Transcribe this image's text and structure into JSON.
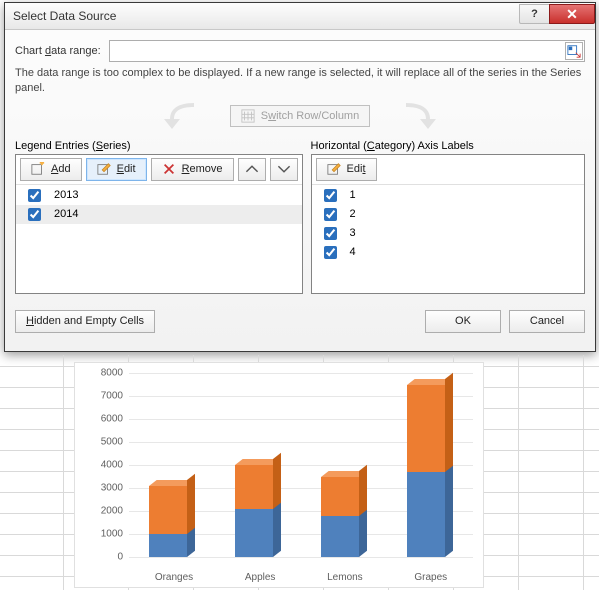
{
  "dialog": {
    "title": "Select Data Source",
    "help_tip": "?",
    "close_tip": "X",
    "range_label_pre": "Chart ",
    "range_label_u": "d",
    "range_label_post": "ata range:",
    "range_value": "",
    "note": "The data range is too complex to be displayed. If a new range is selected, it will replace all of the series in the Series panel.",
    "switch_label_pre": "S",
    "switch_label_u": "w",
    "switch_label_post": "itch Row/Column",
    "series_panel": {
      "label_pre": "Legend Entries (",
      "label_u": "S",
      "label_post": "eries)",
      "add": "Add",
      "edit": "Edit",
      "remove": "Remove",
      "items": [
        {
          "label": "2013",
          "checked": true
        },
        {
          "label": "2014",
          "checked": true
        }
      ]
    },
    "category_panel": {
      "label_pre": "Horizontal (",
      "label_u": "C",
      "label_post": "ategory) Axis Labels",
      "edit": "Edit",
      "items": [
        {
          "label": "1",
          "checked": true
        },
        {
          "label": "2",
          "checked": true
        },
        {
          "label": "3",
          "checked": true
        },
        {
          "label": "4",
          "checked": true
        }
      ]
    },
    "hidden_btn": "Hidden and Empty Cells",
    "ok": "OK",
    "cancel": "Cancel"
  },
  "chart_data": {
    "type": "bar",
    "stacked": true,
    "categories": [
      "Oranges",
      "Apples",
      "Lemons",
      "Grapes"
    ],
    "series": [
      {
        "name": "2013",
        "color": "#4f81bd",
        "values": [
          1000,
          2100,
          1800,
          3700
        ]
      },
      {
        "name": "2014",
        "color": "#ed7d31",
        "values": [
          2100,
          1900,
          1700,
          3800
        ]
      }
    ],
    "yticks": [
      0,
      1000,
      2000,
      3000,
      4000,
      5000,
      6000,
      7000,
      8000
    ],
    "ylim": [
      0,
      8000
    ],
    "title": "",
    "xlabel": "",
    "ylabel": ""
  }
}
